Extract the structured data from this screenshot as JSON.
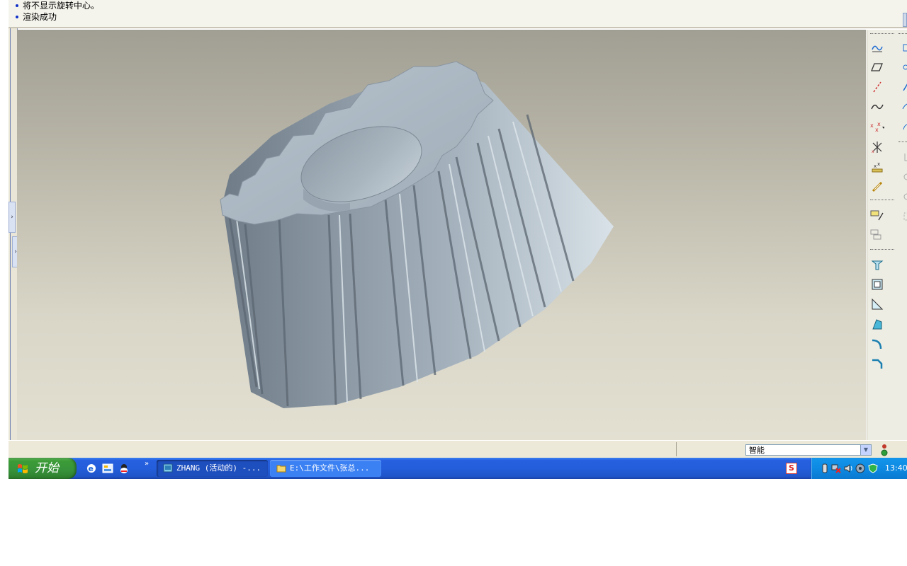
{
  "messages": [
    "将不显示旋转中心。",
    "渲染成功"
  ],
  "status": {
    "filter_value": "智能"
  },
  "taskbar": {
    "start_label": "开始",
    "more": "»",
    "tasks": [
      "ZHANG (活动的) -...",
      "E:\\工作文件\\张总..."
    ],
    "ime": "S",
    "clock": "13:40"
  },
  "colors": {
    "viewport_top": "#a19f93",
    "viewport_bottom": "#e3e0d2",
    "gear": "#a7b4bf",
    "taskbar": "#245edb",
    "start": "#37923a",
    "tray": "#0d8ae3"
  },
  "icons": {
    "toolbar_col1": [
      "datum-plane-icon",
      "datum-axis-icon",
      "datum-curve-icon",
      "sketch-spline-icon",
      "datum-point-icon",
      "coordinate-system-icon",
      "analysis-icon",
      "chain-link-icon",
      "sketch-tool-icon",
      "sketch-edit-icon",
      "extrude-icon",
      "shell-icon",
      "rib-icon",
      "draft-icon",
      "round-icon",
      "chamfer-icon"
    ]
  }
}
